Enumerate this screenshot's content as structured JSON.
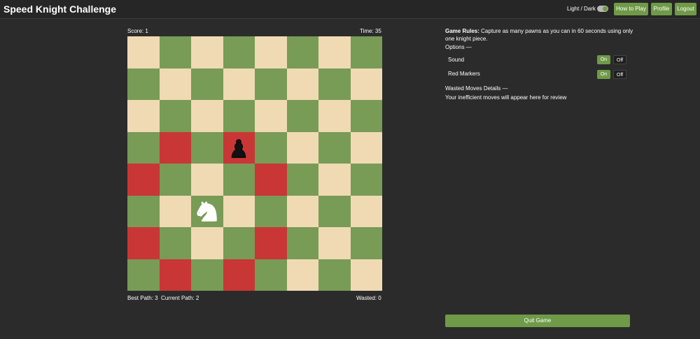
{
  "header": {
    "title": "Speed Knight Challenge",
    "theme_label": "Light / Dark",
    "buttons": {
      "how_to_play": "How to Play",
      "profile": "Profile",
      "logout": "Logout"
    }
  },
  "game": {
    "score": "Score: 1",
    "time": "Time: 35",
    "best_path": "Best Path: 3",
    "current_path": "Current Path: 2",
    "wasted": "Wasted: 0",
    "board": {
      "rows": 8,
      "cols": 8,
      "red_squares": [
        [
          3,
          1
        ],
        [
          3,
          3
        ],
        [
          4,
          0
        ],
        [
          4,
          4
        ],
        [
          6,
          0
        ],
        [
          6,
          4
        ],
        [
          7,
          1
        ],
        [
          7,
          3
        ]
      ],
      "pieces": [
        {
          "type": "black-pawn",
          "row": 3,
          "col": 3
        },
        {
          "type": "white-knight",
          "row": 5,
          "col": 2
        }
      ]
    }
  },
  "panel": {
    "rules_title": "Game Rules:",
    "rules_text": "Capture as many pawns as you can in 60 seconds using only one knight piece.",
    "options_header": "Options —",
    "sound_label": "Sound",
    "markers_label": "Red Markers",
    "on_label": "On",
    "off_label": "Off",
    "wasted_header": "Wasted Moves Details —",
    "wasted_text": "Your inefficient moves will appear here for review",
    "quit_label": "Quit Game"
  },
  "colors": {
    "accent": "#6f9a47",
    "light_square": "#f0dab4",
    "dark_square": "#789b56",
    "red_marker": "#c93636"
  }
}
